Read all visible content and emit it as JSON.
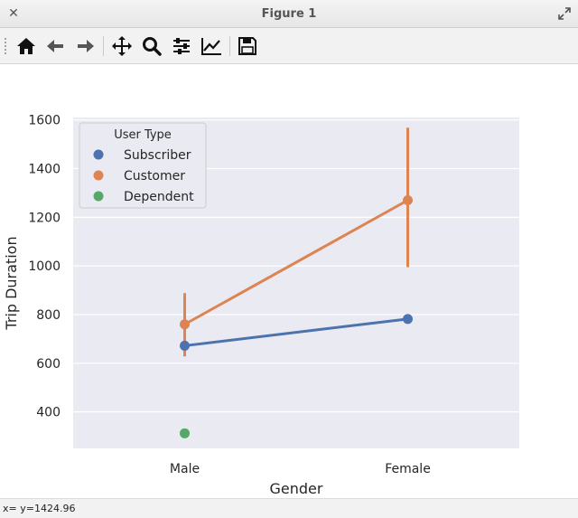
{
  "window": {
    "title": "Figure 1"
  },
  "toolbar": {
    "buttons": [
      {
        "name": "home",
        "icon": "home-icon"
      },
      {
        "name": "back",
        "icon": "arrow-left-icon"
      },
      {
        "name": "forward",
        "icon": "arrow-right-icon"
      },
      {
        "name": "pan",
        "icon": "move-icon"
      },
      {
        "name": "zoom",
        "icon": "magnifier-icon"
      },
      {
        "name": "configure-subplots",
        "icon": "sliders-icon"
      },
      {
        "name": "edit-axis",
        "icon": "line-chart-icon"
      },
      {
        "name": "save",
        "icon": "floppy-disk-icon"
      }
    ]
  },
  "status": {
    "text": "x= y=1424.96"
  },
  "chart_data": {
    "type": "line",
    "categories": [
      "Male",
      "Female"
    ],
    "xlabel": "Gender",
    "ylabel": "Trip Duration",
    "ylim": [
      250,
      1610
    ],
    "yticks": [
      "400",
      "600",
      "800",
      "1000",
      "1200",
      "1400",
      "1600"
    ],
    "grid": true,
    "legend": {
      "title": "User Type",
      "placement": "top-left"
    },
    "series": [
      {
        "name": "Subscriber",
        "color": "#4c72b0",
        "values": [
          672,
          782
        ],
        "ci": [
          [
            662,
            682
          ],
          [
            774,
            790
          ]
        ]
      },
      {
        "name": "Customer",
        "color": "#dd8452",
        "values": [
          760,
          1270
        ],
        "ci": [
          [
            628,
            888
          ],
          [
            995,
            1568
          ]
        ]
      },
      {
        "name": "Dependent",
        "color": "#55a868",
        "values": [
          312,
          null
        ],
        "ci": [
          null,
          null
        ]
      }
    ]
  }
}
